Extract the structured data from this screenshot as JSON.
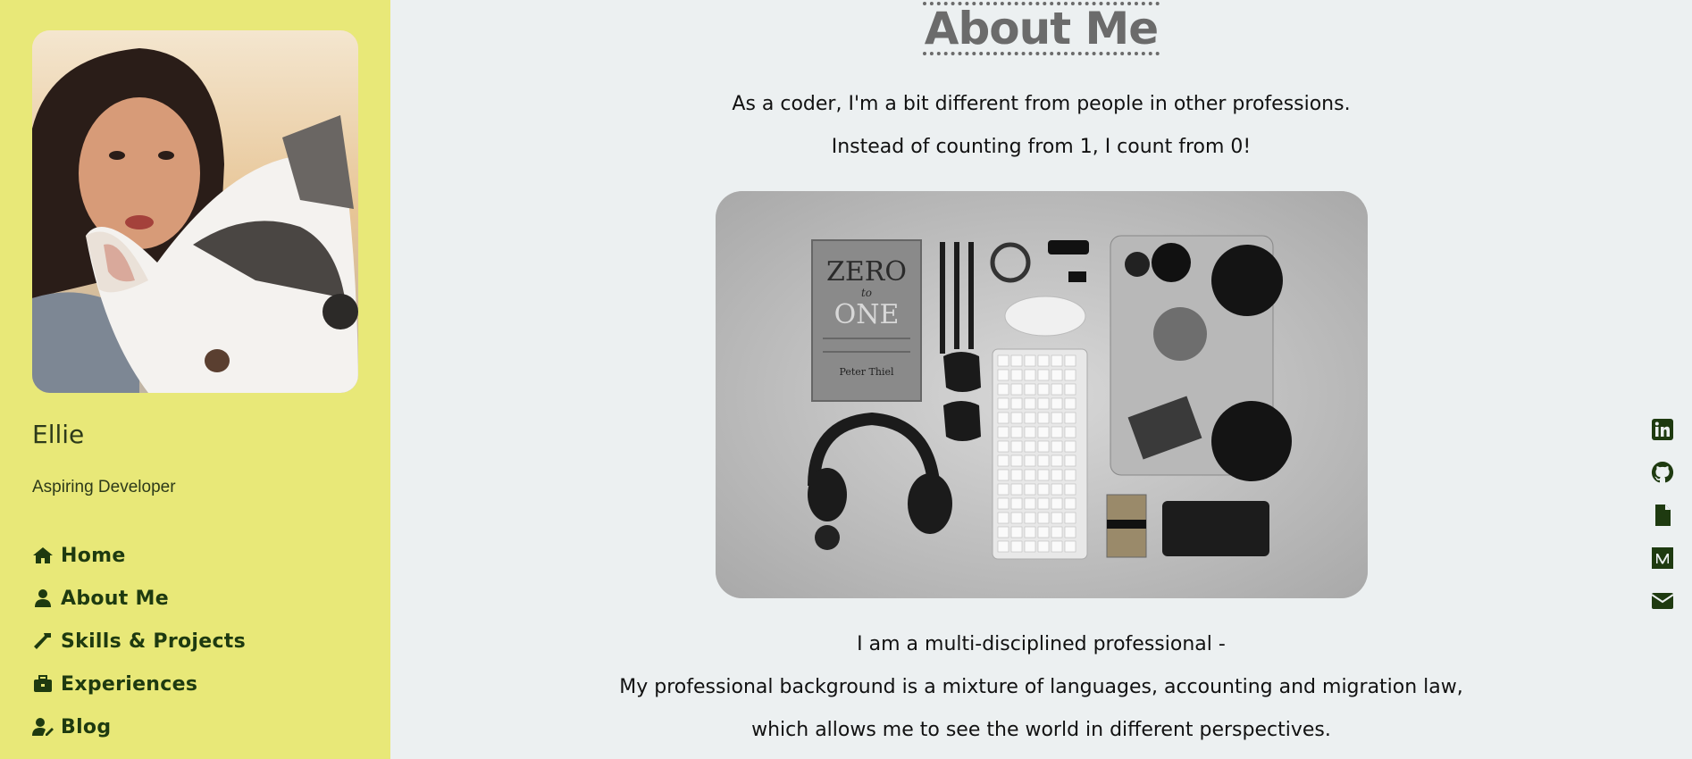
{
  "sidebar": {
    "name": "Ellie",
    "role": "Aspiring Developer",
    "nav": [
      {
        "label": "Home",
        "icon": "home-icon"
      },
      {
        "label": "About Me",
        "icon": "user-icon"
      },
      {
        "label": "Skills & Projects",
        "icon": "hammer-icon"
      },
      {
        "label": "Experiences",
        "icon": "briefcase-icon"
      },
      {
        "label": "Blog",
        "icon": "user-edit-icon"
      }
    ]
  },
  "main": {
    "title": "About Me",
    "intro": [
      "As a coder, I'm a bit different from people in other professions.",
      "Instead of counting from 1, I count from 0!"
    ],
    "image_book_title": [
      "ZERO",
      "to",
      "ONE"
    ],
    "image_book_author": "Peter Thiel",
    "body": [
      "I am a multi-disciplined professional -",
      "My professional background is a mixture of languages, accounting and migration law,",
      "which allows me to see the world in different perspectives."
    ]
  },
  "social": [
    {
      "icon": "linkedin-icon"
    },
    {
      "icon": "github-icon"
    },
    {
      "icon": "file-icon"
    },
    {
      "icon": "medium-icon"
    },
    {
      "icon": "envelope-icon"
    }
  ],
  "colors": {
    "sidebar_bg": "#e8e878",
    "main_bg": "#ecf0f1",
    "nav_text": "#1e3a10",
    "title_text": "#6b6b6b"
  }
}
